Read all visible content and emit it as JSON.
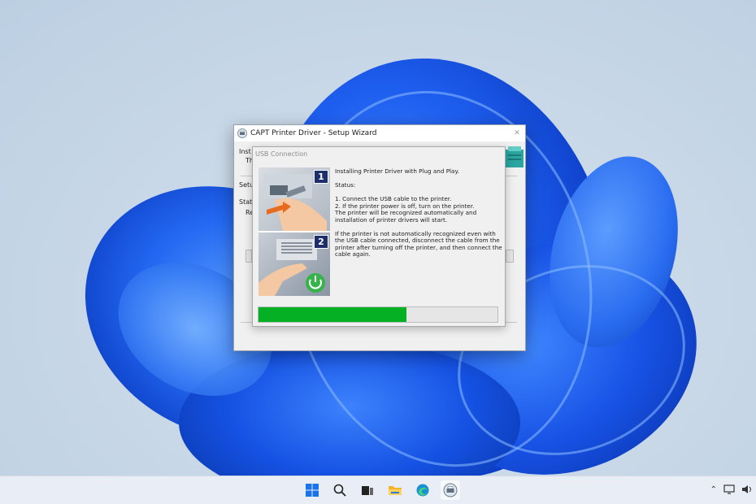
{
  "wizard": {
    "title": "CAPT Printer Driver - Setup Wizard",
    "behind_texts": [
      "Inst",
      "Th",
      "Setu",
      "Stat",
      "Re"
    ]
  },
  "usb_dialog": {
    "title": "USB Connection",
    "heading": "Installing Printer Driver with Plug and Play.",
    "status_label": "Status:",
    "step1": "1. Connect the USB cable to the printer.",
    "step2": "2. If the printer power is off, turn on the printer.",
    "step3": "The printer will be recognized automatically and installation of printer drivers will start.",
    "note": "If the printer is not automatically recognized even with the USB cable connected, disconnect the cable from the printer after turning off the printer, and then connect the cable again.",
    "panel_numbers": [
      "1",
      "2"
    ],
    "progress_percent": 62,
    "progress_color": "#06b025"
  },
  "taskbar": {
    "icons": [
      "windows-start-icon",
      "search-icon",
      "task-view-icon",
      "file-explorer-icon",
      "edge-icon",
      "setup-app-icon"
    ],
    "tray": [
      "chevron-up-icon",
      "display-icon",
      "volume-icon"
    ]
  }
}
